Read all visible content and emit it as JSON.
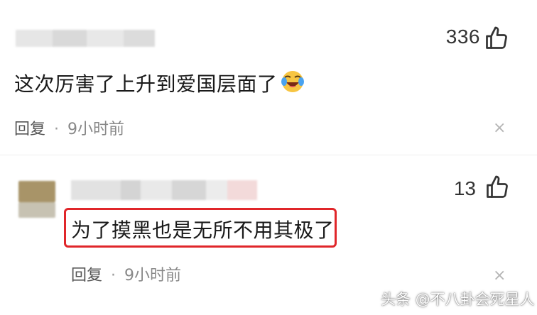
{
  "comments": [
    {
      "likes": "336",
      "text": "这次厉害了上升到爱国层面了",
      "reply_label": "回复",
      "separator": "·",
      "time": "9小时前",
      "close_glyph": "×"
    },
    {
      "likes": "13",
      "text": "为了摸黑也是无所不用其极了",
      "reply_label": "回复",
      "separator": "·",
      "time": "9小时前",
      "close_glyph": "×"
    }
  ],
  "watermark": "头条 @不八卦会死星人",
  "icons": {
    "like": "thumbs-up-icon",
    "emoji": "crying-laughing-emoji",
    "close": "close-icon"
  },
  "colors": {
    "highlight_border": "#e0262a",
    "text": "#1a1a1a",
    "meta": "#888888"
  }
}
